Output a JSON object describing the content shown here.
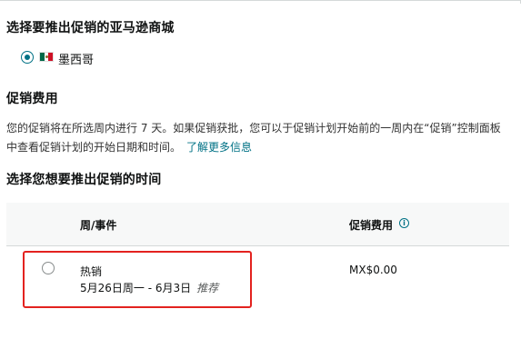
{
  "marketplace": {
    "heading": "选择要推出促销的亚马逊商城",
    "selected_country": "墨西哥",
    "flag_icon": "mexico-flag-icon"
  },
  "fee": {
    "heading": "促销费用",
    "description": "您的促销将在所选周内进行 7 天。如果促销获批，您可以于促销计划开始前的一周内在“促销”控制面板中查看促销计划的开始日期和时间。",
    "learn_more": "了解更多信息"
  },
  "schedule": {
    "heading": "选择您想要推出促销的时间",
    "columns": {
      "week_event": "周/事件",
      "promo_fee": "促销费用"
    },
    "rows": [
      {
        "title": "热销",
        "dates": "5月26日周一 - 6月3日",
        "badge": "推荐",
        "fee": "MX$0.00",
        "selected": false
      }
    ]
  },
  "colors": {
    "link": "#007185",
    "highlight": "#e3221f"
  }
}
